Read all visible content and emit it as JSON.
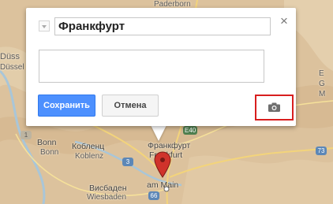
{
  "map": {
    "labels": {
      "paderborn": "Paderborn",
      "dusseldorf_fragment": "Düss",
      "dusseldorf_fragment_2": "Düsseldorf",
      "bonn_1": "Bonn",
      "bonn_2": "Bonn",
      "koblenz_1": "Кобленц",
      "koblenz_2": "Koblenz",
      "frankfurt_ru": "Франкфурт",
      "frankfurt_de": "Frankfurt",
      "am_main": "am Main",
      "wiesbaden_ru": "Висбаден",
      "wiesbaden_de": "Wiesbaden",
      "right_e": "E",
      "right_g": "G",
      "right_m": "M"
    },
    "shields": {
      "a1": "1",
      "e40": "E40",
      "a3": "3",
      "a7": "7",
      "a73": "73",
      "a66": "66",
      "a45": "45"
    },
    "marker_color": "#d0332b"
  },
  "popup": {
    "title_value": "Франкфурт",
    "description_value": "",
    "save_label": "Сохранить",
    "cancel_label": "Отмена",
    "close_symbol": "×",
    "photo_icon": "camera-icon",
    "highlight_color": "#d81e1e"
  }
}
